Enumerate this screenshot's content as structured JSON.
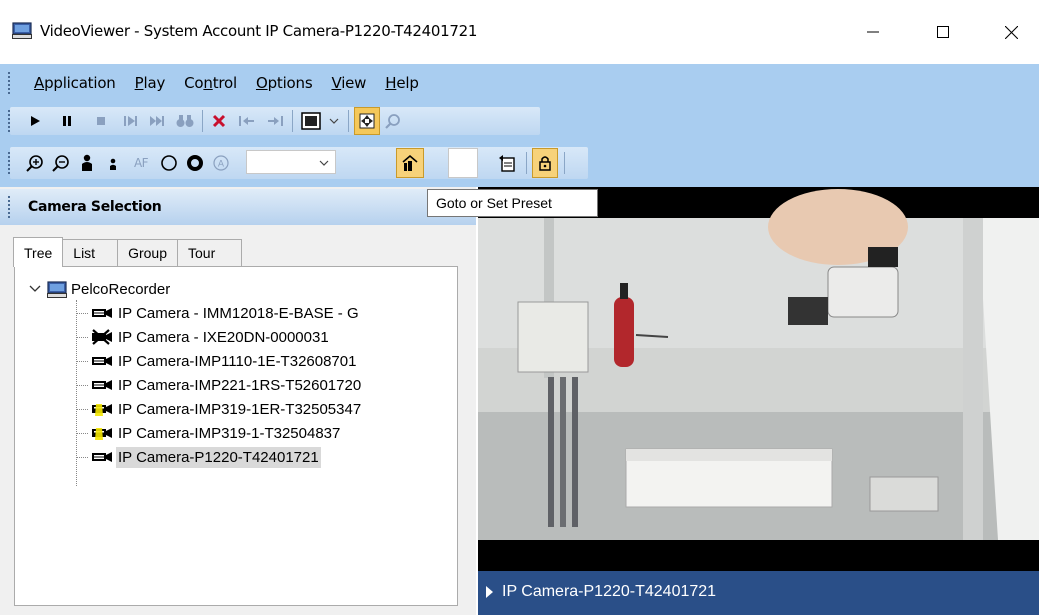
{
  "window": {
    "title": "VideoViewer - System Account IP Camera-P1220-T42401721"
  },
  "menu": [
    {
      "label": "Application",
      "mnemonic": "A",
      "rest": "pplication"
    },
    {
      "label": "Play",
      "mnemonic": "P",
      "rest": "lay"
    },
    {
      "label": "Control",
      "pre": "Co",
      "mnemonic": "n",
      "rest": "trol"
    },
    {
      "label": "Options",
      "mnemonic": "O",
      "rest": "ptions"
    },
    {
      "label": "View",
      "mnemonic": "V",
      "rest": "iew"
    },
    {
      "label": "Help",
      "mnemonic": "H",
      "rest": "elp"
    }
  ],
  "toolbar2": {
    "af_label": "AF",
    "preset_select_value": ""
  },
  "tooltip": "Goto or Set Preset",
  "panel": {
    "title": "Camera Selection",
    "tabs": [
      "Tree",
      "List",
      "Group",
      "Tour"
    ],
    "active_tab": "Tree"
  },
  "tree": {
    "root": "PelcoRecorder",
    "items": [
      {
        "label": "IP Camera - IMM12018-E-BASE - G",
        "status": "normal"
      },
      {
        "label": "IP Camera - IXE20DN-0000031",
        "status": "offline"
      },
      {
        "label": "IP Camera-IMP1110-1E-T32608701",
        "status": "normal"
      },
      {
        "label": "IP Camera-IMP221-1RS-T52601720",
        "status": "normal"
      },
      {
        "label": "IP Camera-IMP319-1ER-T32505347",
        "status": "warning"
      },
      {
        "label": "IP Camera-IMP319-1-T32504837",
        "status": "warning"
      },
      {
        "label": "IP Camera-P1220-T42401721",
        "status": "normal",
        "selected": true
      }
    ]
  },
  "video": {
    "camera_label": "IP Camera-P1220-T42401721"
  },
  "colors": {
    "chrome": "#a9cdf0",
    "video_bar": "#2a4f88",
    "selection": "#d9d9d9"
  }
}
